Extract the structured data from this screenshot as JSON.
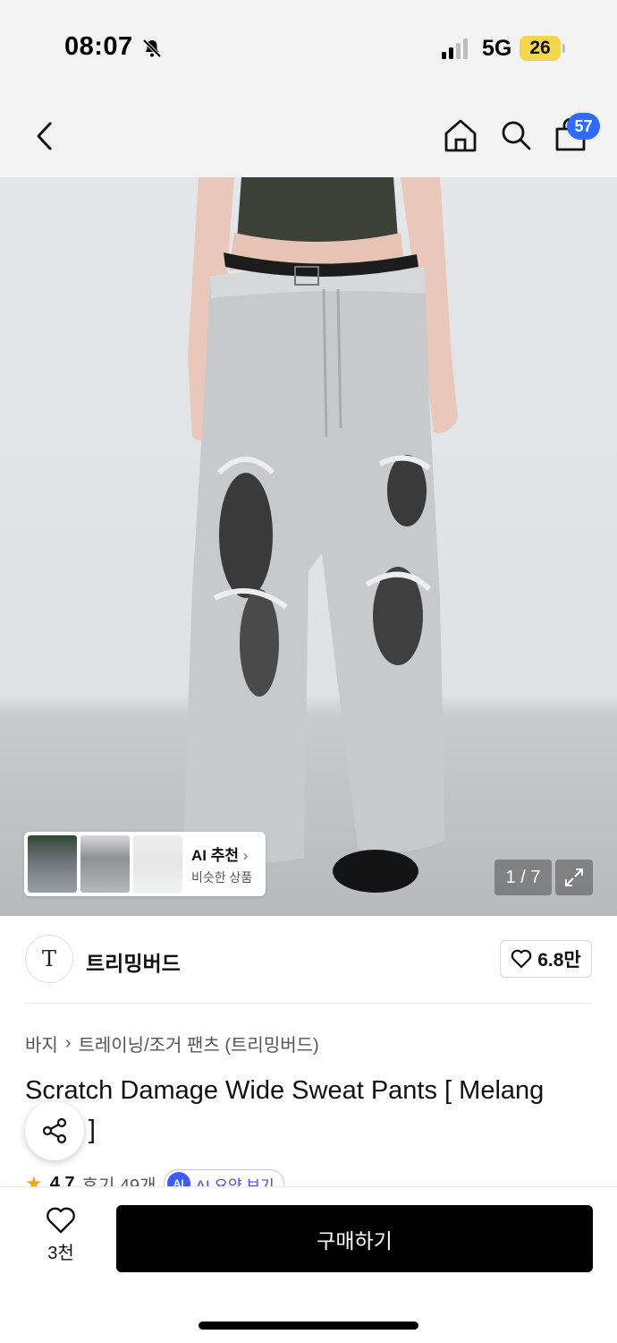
{
  "status_bar": {
    "time": "08:07",
    "network": "5G",
    "battery": "26"
  },
  "header": {
    "cart_count": "57"
  },
  "gallery": {
    "ai_card": {
      "title": "AI 추천",
      "subtitle": "비슷한 상품"
    },
    "counter": "1 / 7"
  },
  "brand": {
    "logo_text": "T",
    "name": "트리밍버드",
    "likes": "6.8만"
  },
  "breadcrumb": {
    "category": "바지",
    "subcategory": "트레이닝/조거 팬츠 (트리밍버드)"
  },
  "product": {
    "title": "Scratch Damage Wide Sweat Pants [ Melang Gray ]",
    "rating": "4.7",
    "reviews": "후기 49개",
    "ai_summary_badge": "AI",
    "ai_summary_label": "AI 요약 보기"
  },
  "bottom_bar": {
    "wish_count": "3천",
    "buy_label": "구매하기"
  },
  "colors": {
    "accent_blue": "#2f6bff",
    "buy_button": "#000000",
    "star": "#f5a623",
    "battery": "#f3d64e"
  }
}
